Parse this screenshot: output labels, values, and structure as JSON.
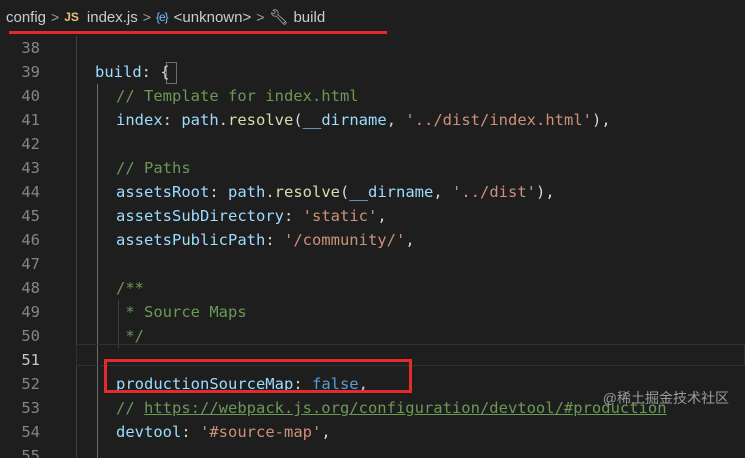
{
  "breadcrumb": {
    "folder": "config",
    "file_badge": "JS",
    "file": "index.js",
    "symbol_icon": "{e}",
    "symbol": "<unknown>",
    "last": "build",
    "separator": ">"
  },
  "code_lines": [
    {
      "num": "38"
    },
    {
      "num": "39"
    },
    {
      "num": "40"
    },
    {
      "num": "41"
    },
    {
      "num": "42"
    },
    {
      "num": "43"
    },
    {
      "num": "44"
    },
    {
      "num": "45"
    },
    {
      "num": "46"
    },
    {
      "num": "47"
    },
    {
      "num": "48"
    },
    {
      "num": "49"
    },
    {
      "num": "50"
    },
    {
      "num": "51"
    },
    {
      "num": "52"
    },
    {
      "num": "53"
    },
    {
      "num": "54"
    },
    {
      "num": "55"
    }
  ],
  "tokens": {
    "l39": {
      "prop": "build",
      "punc": ": ",
      "brace": "{"
    },
    "l40": {
      "cmt": "// Template for index.html"
    },
    "l41": {
      "prop": "index",
      "p1": ": ",
      "obj": "path",
      "dot": ".",
      "fn": "resolve",
      "p2": "(",
      "arg": "__dirname",
      "p3": ", ",
      "str": "'../dist/index.html'",
      "p4": "),"
    },
    "l43": {
      "cmt": "// Paths"
    },
    "l44": {
      "prop": "assetsRoot",
      "p1": ": ",
      "obj": "path",
      "dot": ".",
      "fn": "resolve",
      "p2": "(",
      "arg": "__dirname",
      "p3": ", ",
      "str": "'../dist'",
      "p4": "),"
    },
    "l45": {
      "prop": "assetsSubDirectory",
      "p1": ": ",
      "str": "'static'",
      "p2": ","
    },
    "l46": {
      "prop": "assetsPublicPath",
      "p1": ": ",
      "str": "'/community/'",
      "p2": ","
    },
    "l48": {
      "cmt": "/**"
    },
    "l49": {
      "cmt": " * Source Maps"
    },
    "l50": {
      "cmt": " */"
    },
    "l52": {
      "prop": "productionSourceMap",
      "p1": ": ",
      "kw": "false",
      "p2": ","
    },
    "l53": {
      "cmt": "// ",
      "link": "https://webpack.js.org/configuration/devtool/#production"
    },
    "l54": {
      "prop": "devtool",
      "p1": ": ",
      "str": "'#source-map'",
      "p2": ","
    }
  },
  "watermark": "@稀土掘金技术社区",
  "colors": {
    "highlight": "#e32b2b",
    "background": "#1e1e1e",
    "comment": "#6a9955",
    "string": "#ce9178",
    "property": "#9cdcfe",
    "keyword": "#569cd6"
  },
  "icons": [
    "js-file-icon",
    "symbol-variable-icon",
    "wrench-icon"
  ]
}
